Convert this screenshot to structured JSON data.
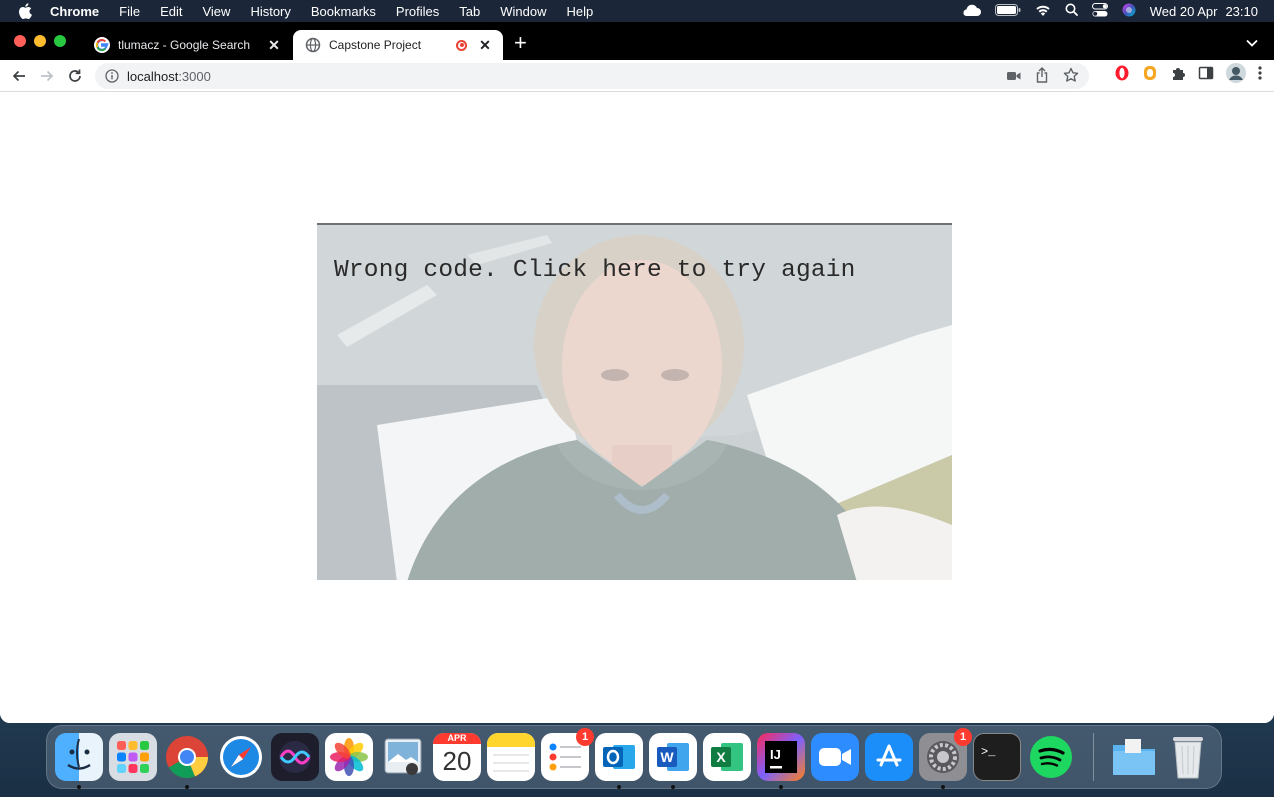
{
  "menubar": {
    "app": "Chrome",
    "items": [
      "File",
      "Edit",
      "View",
      "History",
      "Bookmarks",
      "Profiles",
      "Tab",
      "Window",
      "Help"
    ],
    "date": "Wed 20 Apr",
    "time": "23:10",
    "status_icons": [
      "cloud-icon",
      "battery-icon",
      "wifi-icon",
      "spotlight-icon",
      "control-center-icon",
      "siri-icon"
    ]
  },
  "browser": {
    "tabs": [
      {
        "title": "tlumacz - Google Search",
        "favicon": "google-icon",
        "active": false
      },
      {
        "title": "Capstone Project",
        "favicon": "globe-icon",
        "active": true,
        "recording": true
      }
    ],
    "url_host": "localhost",
    "url_port": ":3000",
    "accent": "#1a73e8"
  },
  "page": {
    "message": "Wrong code. Click here to try again"
  },
  "dock": {
    "calendar_month": "APR",
    "calendar_day": "20",
    "reminders_badge": "1",
    "settings_badge": "1",
    "apps": [
      "Finder",
      "Launchpad",
      "Chrome",
      "Safari",
      "Siri",
      "Photos",
      "Preview",
      "Calendar",
      "Notes",
      "Reminders",
      "Outlook",
      "Word",
      "Excel",
      "IntelliJ IDEA",
      "Zoom",
      "App Store",
      "System Preferences",
      "Terminal",
      "Spotify",
      "Downloads",
      "Trash"
    ]
  }
}
